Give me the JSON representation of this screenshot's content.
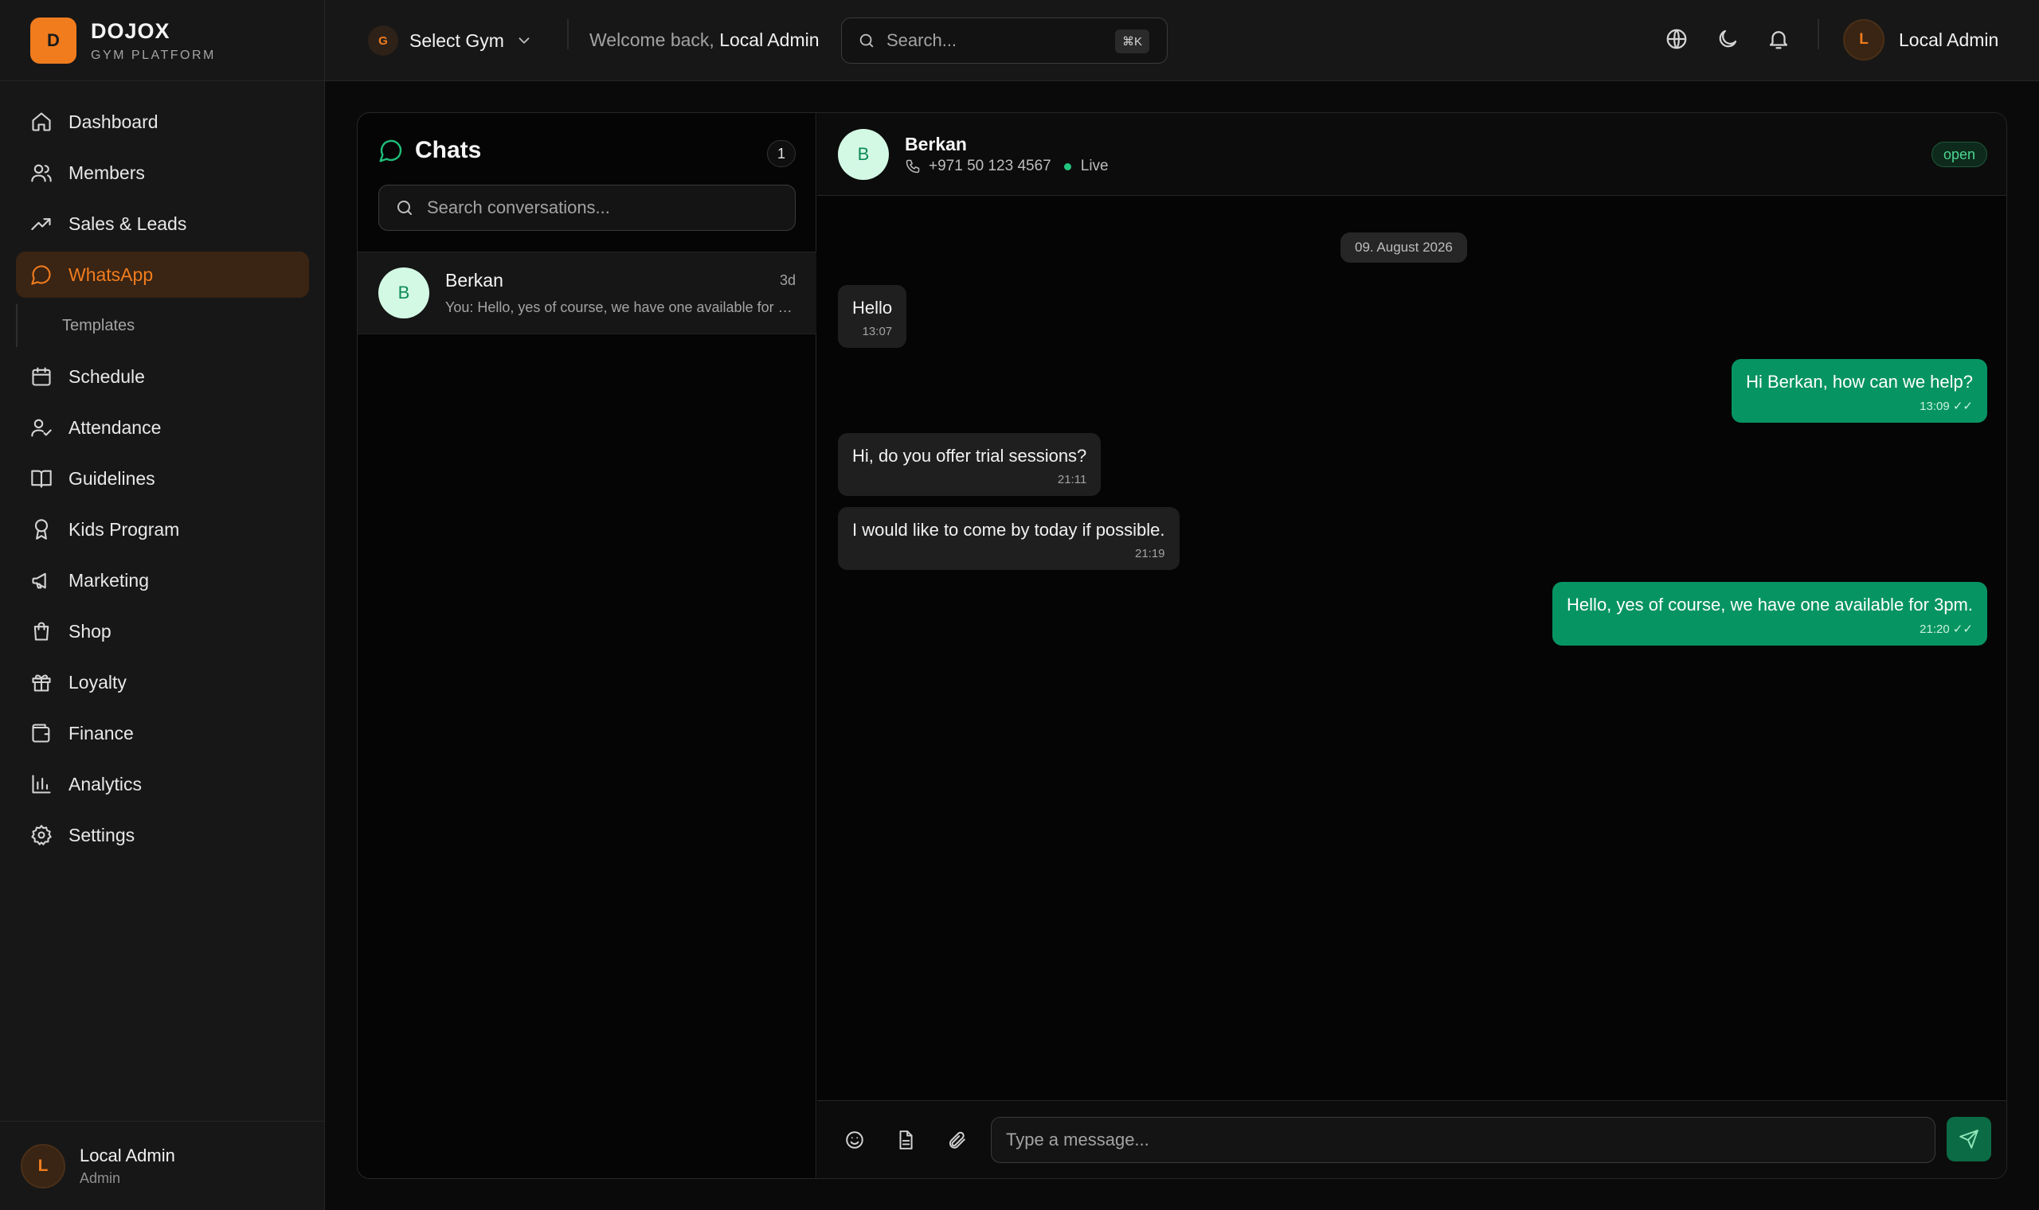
{
  "brand": {
    "logo_letter": "D",
    "name": "DOJOX",
    "subtitle": "GYM PLATFORM",
    "accent": "#f07c1e"
  },
  "sidebar": {
    "items": [
      {
        "label": "Dashboard",
        "icon": "home-icon"
      },
      {
        "label": "Members",
        "icon": "users-icon"
      },
      {
        "label": "Sales & Leads",
        "icon": "trending-up-icon"
      },
      {
        "label": "WhatsApp",
        "icon": "chat-bubble-icon",
        "active": true
      },
      {
        "label": "Schedule",
        "icon": "calendar-icon"
      },
      {
        "label": "Attendance",
        "icon": "user-check-icon"
      },
      {
        "label": "Guidelines",
        "icon": "book-icon"
      },
      {
        "label": "Kids Program",
        "icon": "award-icon"
      },
      {
        "label": "Marketing",
        "icon": "megaphone-icon"
      },
      {
        "label": "Shop",
        "icon": "shopping-bag-icon"
      },
      {
        "label": "Loyalty",
        "icon": "gift-icon"
      },
      {
        "label": "Finance",
        "icon": "wallet-icon"
      },
      {
        "label": "Analytics",
        "icon": "bar-chart-icon"
      },
      {
        "label": "Settings",
        "icon": "gear-icon"
      }
    ],
    "subitem": {
      "label": "Templates"
    },
    "footer": {
      "avatar_letter": "L",
      "name": "Local Admin",
      "role": "Admin"
    }
  },
  "topbar": {
    "gym_letter": "G",
    "gym_label": "Select Gym",
    "welcome_prefix": "Welcome back, ",
    "welcome_name": "Local Admin",
    "search_placeholder": "Search...",
    "search_shortcut": "⌘K",
    "user_letter": "L",
    "user_name": "Local Admin"
  },
  "chats": {
    "title": "Chats",
    "count": "1",
    "search_placeholder": "Search conversations...",
    "conversations": [
      {
        "avatar_letter": "B",
        "name": "Berkan",
        "time": "3d",
        "preview": "You: Hello, yes of course, we have one available for 3pm."
      }
    ]
  },
  "thread": {
    "contact": {
      "avatar_letter": "B",
      "name": "Berkan",
      "phone": "+971 50 123 4567",
      "status": "Live"
    },
    "badge": "open",
    "date": "09. August 2026",
    "messages": [
      {
        "dir": "in",
        "text": "Hello",
        "time": "13:07"
      },
      {
        "dir": "out",
        "text": "Hi Berkan, how can we help?",
        "time": "13:09 ✓✓"
      },
      {
        "dir": "in",
        "text": "Hi, do you offer trial sessions?",
        "time": "21:11"
      },
      {
        "dir": "in",
        "text": "I would like to come by today if possible.",
        "time": "21:19"
      },
      {
        "dir": "out",
        "text": "Hello, yes of course, we have one available for 3pm.",
        "time": "21:20 ✓✓"
      }
    ],
    "composer_placeholder": "Type a message..."
  },
  "colors": {
    "bubble_out": "#079463",
    "bubble_in": "#1f1f1f",
    "status_live": "#22c57e"
  }
}
